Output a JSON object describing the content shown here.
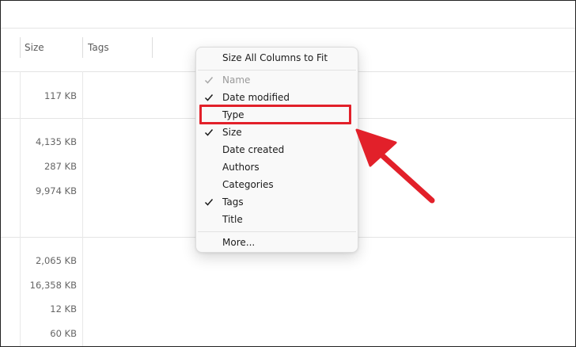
{
  "columns": {
    "size_header": "Size",
    "tags_header": "Tags"
  },
  "rows": [
    {
      "size": "117 KB"
    },
    {
      "size": "4,135 KB"
    },
    {
      "size": "287 KB"
    },
    {
      "size": "9,974 KB"
    },
    {
      "size": "2,065 KB"
    },
    {
      "size": "16,358 KB"
    },
    {
      "size": "12 KB"
    },
    {
      "size": "60 KB"
    }
  ],
  "context_menu": {
    "fit_all": "Size All Columns to Fit",
    "items": [
      {
        "label": "Name",
        "checked": true,
        "disabled": true
      },
      {
        "label": "Date modified",
        "checked": true,
        "disabled": false
      },
      {
        "label": "Type",
        "checked": false,
        "disabled": false
      },
      {
        "label": "Size",
        "checked": true,
        "disabled": false
      },
      {
        "label": "Date created",
        "checked": false,
        "disabled": false
      },
      {
        "label": "Authors",
        "checked": false,
        "disabled": false
      },
      {
        "label": "Categories",
        "checked": false,
        "disabled": false
      },
      {
        "label": "Tags",
        "checked": true,
        "disabled": false
      },
      {
        "label": "Title",
        "checked": false,
        "disabled": false
      }
    ],
    "more": "More..."
  },
  "annotation": {
    "highlight_color": "#e2202a",
    "arrow_color": "#e2202a"
  }
}
